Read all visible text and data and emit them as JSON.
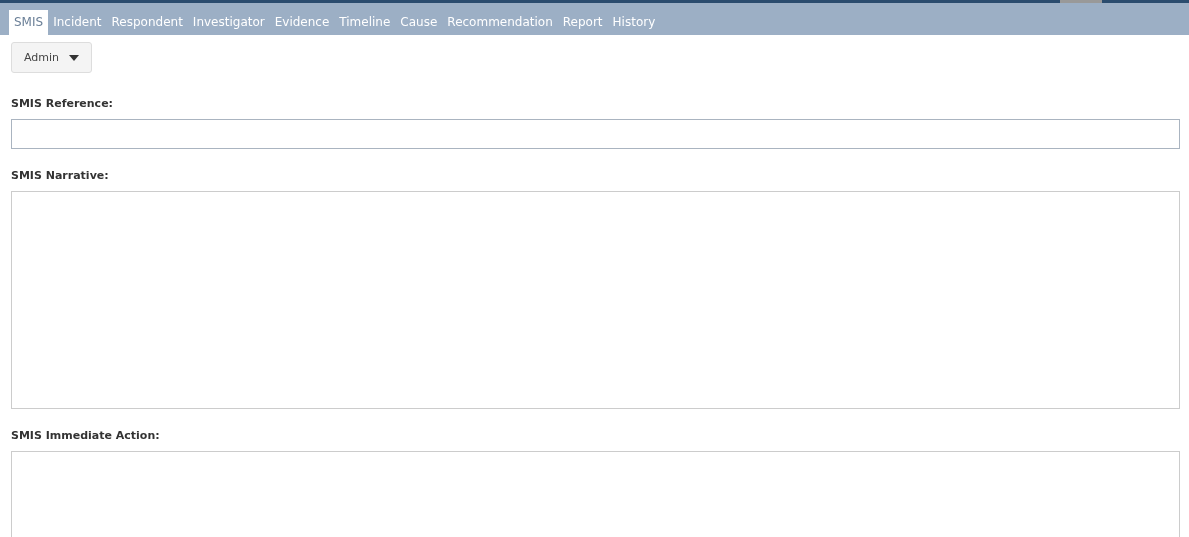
{
  "tabs": [
    {
      "label": "SMIS",
      "selected": true
    },
    {
      "label": "Incident",
      "selected": false
    },
    {
      "label": "Respondent",
      "selected": false
    },
    {
      "label": "Investigator",
      "selected": false
    },
    {
      "label": "Evidence",
      "selected": false
    },
    {
      "label": "Timeline",
      "selected": false
    },
    {
      "label": "Cause",
      "selected": false
    },
    {
      "label": "Recommendation",
      "selected": false
    },
    {
      "label": "Report",
      "selected": false
    },
    {
      "label": "History",
      "selected": false
    }
  ],
  "role_dropdown": {
    "value": "Admin"
  },
  "fields": [
    {
      "label": "SMIS Reference:",
      "kind": "input"
    },
    {
      "label": "SMIS Narrative:",
      "kind": "textarea"
    },
    {
      "label": "SMIS Immediate Action:",
      "kind": "textarea"
    }
  ]
}
